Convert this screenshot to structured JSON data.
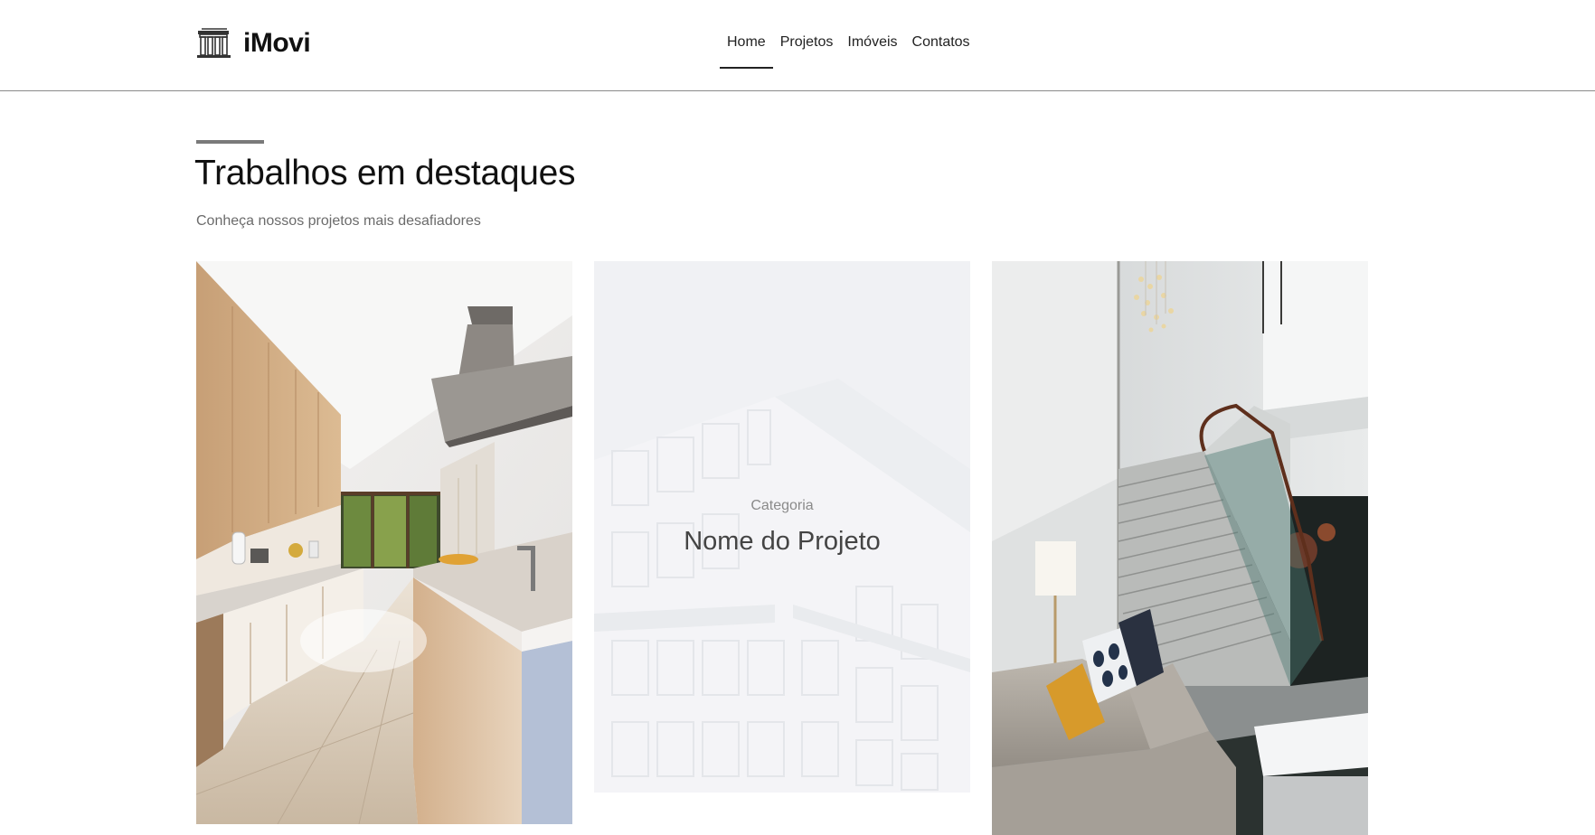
{
  "brand": {
    "name": "iMovi",
    "logo_icon": "building-icon"
  },
  "nav": {
    "items": [
      {
        "label": "Home",
        "active": true
      },
      {
        "label": "Projetos",
        "active": false
      },
      {
        "label": "Imóveis",
        "active": false
      },
      {
        "label": "Contatos",
        "active": false
      }
    ]
  },
  "section": {
    "title": "Trabalhos em destaques",
    "subtitle": "Conheça nossos projetos mais desafiadores"
  },
  "projects": [
    {
      "image": "kitchen-photo"
    },
    {
      "image": "building-facade-photo",
      "category": "Categoria",
      "name": "Nome do Projeto",
      "hovered": true
    },
    {
      "image": "staircase-lobby-photo"
    }
  ],
  "colors": {
    "header_border": "#8a8a8a",
    "accent_rule": "#7a7a7a",
    "subtitle": "#6b6b6b",
    "overlay_bg": "#f3f4f6"
  }
}
